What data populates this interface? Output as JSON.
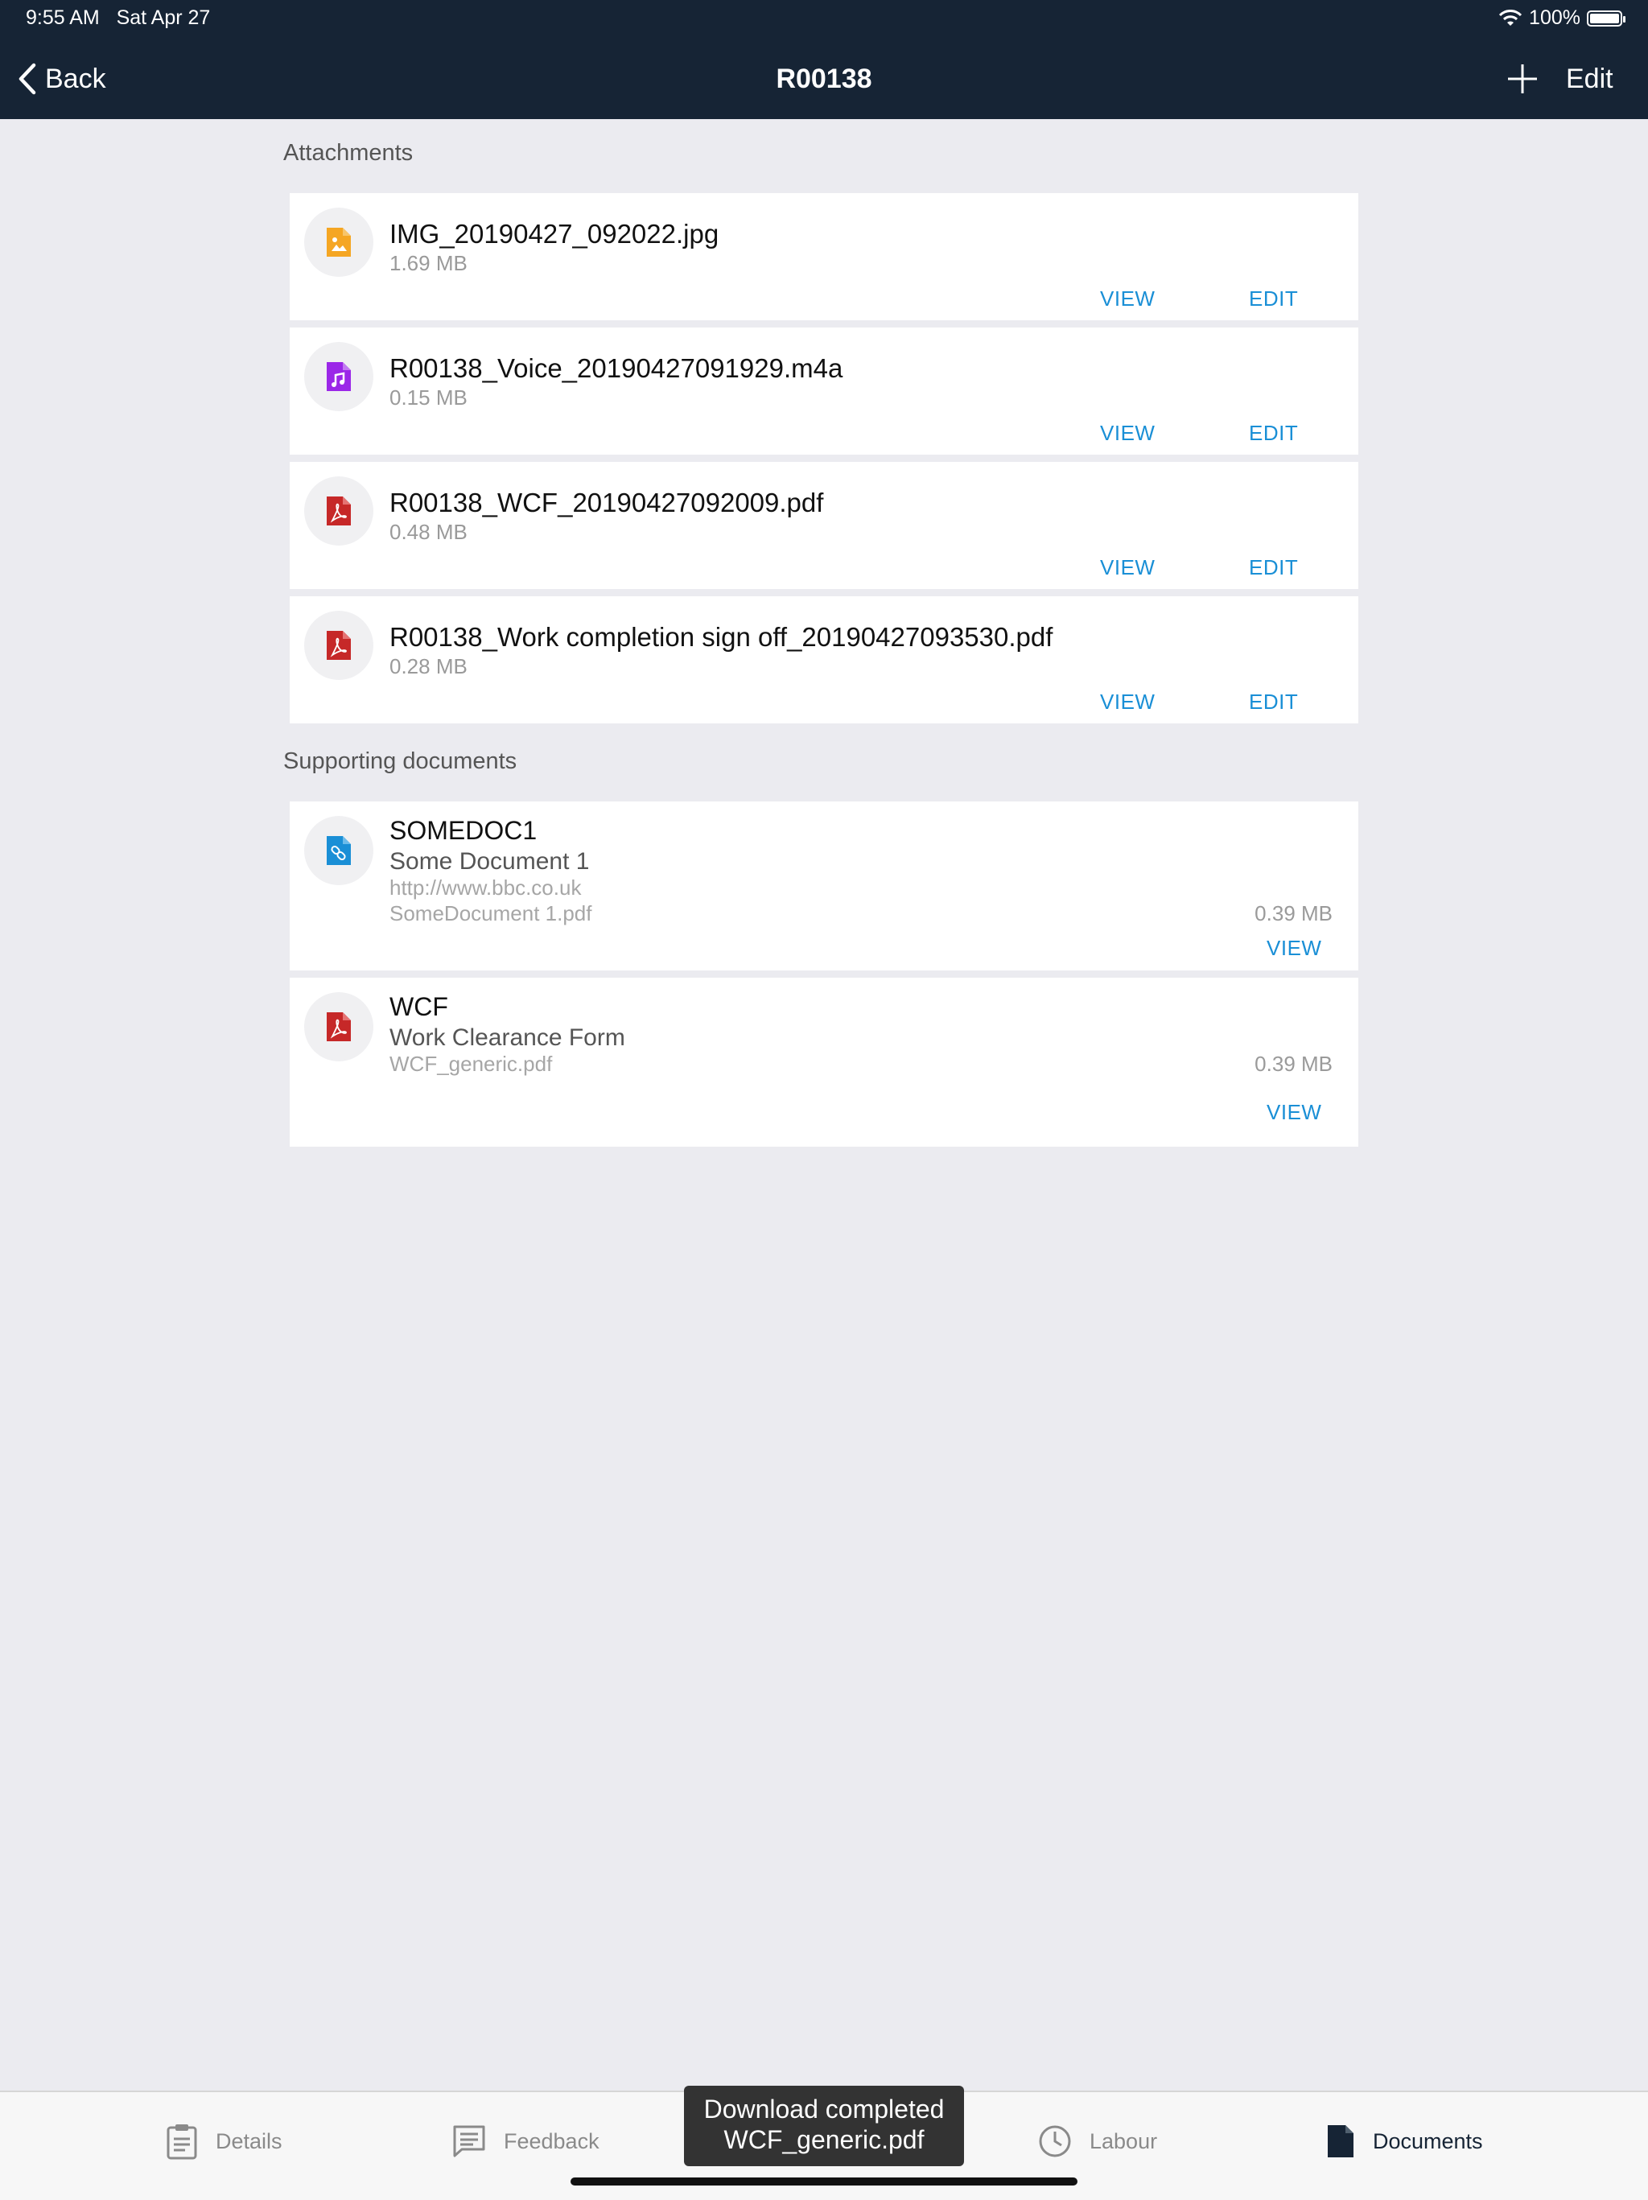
{
  "status": {
    "time": "9:55 AM",
    "date": "Sat Apr 27",
    "battery": "100%"
  },
  "nav": {
    "back_label": "Back",
    "title": "R00138",
    "edit_label": "Edit"
  },
  "attachments": {
    "title": "Attachments",
    "items": [
      {
        "name": "IMG_20190427_092022.jpg",
        "size": "1.69 MB",
        "icon": "image-file-icon",
        "color": "#f5a623",
        "view": "VIEW",
        "edit": "EDIT"
      },
      {
        "name": "R00138_Voice_20190427091929.m4a",
        "size": "0.15 MB",
        "icon": "audio-file-icon",
        "color": "#9b27e8",
        "view": "VIEW",
        "edit": "EDIT"
      },
      {
        "name": "R00138_WCF_20190427092009.pdf",
        "size": "0.48 MB",
        "icon": "pdf-file-icon",
        "color": "#c62828",
        "view": "VIEW",
        "edit": "EDIT"
      },
      {
        "name": "R00138_Work completion sign off_20190427093530.pdf",
        "size": "0.28 MB",
        "icon": "pdf-file-icon",
        "color": "#c62828",
        "view": "VIEW",
        "edit": "EDIT"
      }
    ]
  },
  "supporting": {
    "title": "Supporting documents",
    "items": [
      {
        "code": "SOMEDOC1",
        "description": "Some Document 1",
        "url": "http://www.bbc.co.uk",
        "file": "SomeDocument 1.pdf",
        "size": "0.39 MB",
        "view": "VIEW",
        "icon": "link-file-icon",
        "color": "#1a8fd6"
      },
      {
        "code": "WCF",
        "description": "Work Clearance Form",
        "file": "WCF_generic.pdf",
        "size": "0.39 MB",
        "view": "VIEW",
        "icon": "pdf-file-icon",
        "color": "#c62828"
      }
    ]
  },
  "tabs": [
    {
      "label": "Details",
      "icon": "clipboard-icon"
    },
    {
      "label": "Feedback",
      "icon": "comment-icon"
    },
    {
      "label": "Labour",
      "icon": "clock-icon"
    },
    {
      "label": "Documents",
      "icon": "document-icon",
      "active": true
    }
  ],
  "toast": {
    "line1": "Download completed",
    "line2": "WCF_generic.pdf"
  }
}
